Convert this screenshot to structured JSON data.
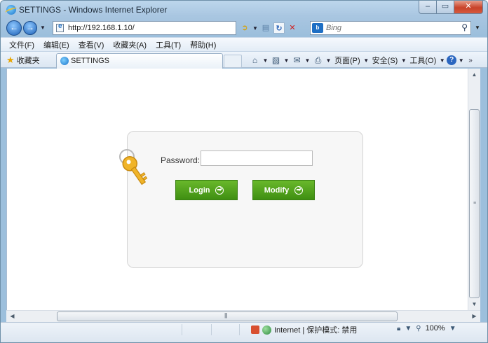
{
  "window": {
    "title": "SETTINGS - Windows Internet Explorer",
    "min_glyph": "–",
    "max_glyph": "▭",
    "close_glyph": "✕"
  },
  "address_bar": {
    "url": "http://192.168.1.10/",
    "search_placeholder": "Bing",
    "search_logo": "Bing"
  },
  "menu": {
    "items": [
      "文件(F)",
      "编辑(E)",
      "查看(V)",
      "收藏夹(A)",
      "工具(T)",
      "帮助(H)"
    ]
  },
  "command_bar": {
    "favorites_label": "收藏夹",
    "tab_title": "SETTINGS",
    "page_label": "页面(P)",
    "safety_label": "安全(S)",
    "tools_label": "工具(O)"
  },
  "login": {
    "password_label": "Password:",
    "password_value": "",
    "login_button": "Login",
    "modify_button": "Modify"
  },
  "status_bar": {
    "zone_text": "Internet | 保护模式: 禁用",
    "zoom": "100%"
  },
  "colors": {
    "button_green": "#4c9f1b",
    "panel_bg": "#f7f7f7",
    "chrome_blue": "#a9c6e1"
  }
}
